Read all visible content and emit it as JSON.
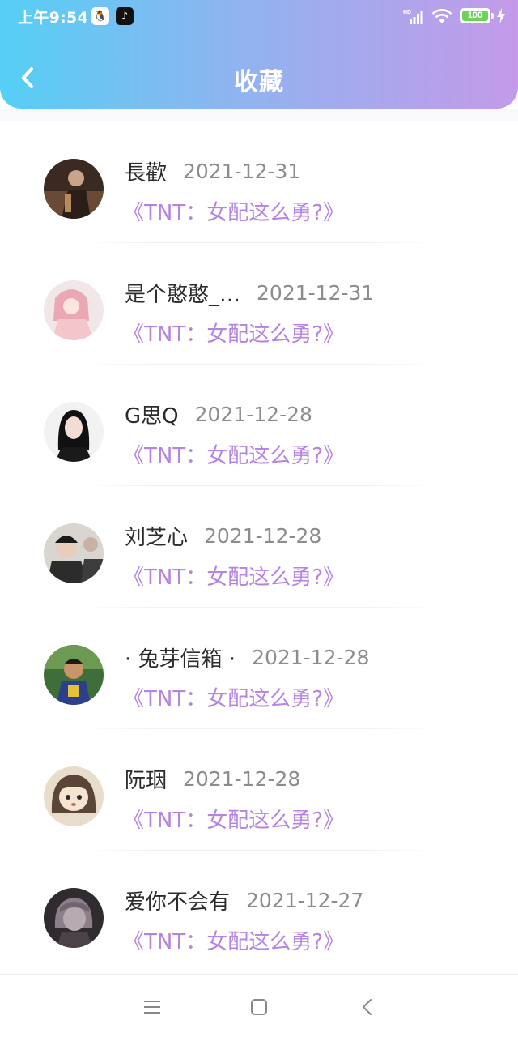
{
  "status_bar": {
    "time": "上午9:54",
    "battery": "100",
    "network": "HD"
  },
  "header": {
    "title": "收藏",
    "back_icon": "chevron-left-icon"
  },
  "favorites": [
    {
      "user": "長歡",
      "date": "2021-12-31",
      "title": "《TNT：女配这么勇?》"
    },
    {
      "user": "是个憨憨_…",
      "date": "2021-12-31",
      "title": "《TNT：女配这么勇?》"
    },
    {
      "user": "G思Q",
      "date": "2021-12-28",
      "title": "《TNT：女配这么勇?》"
    },
    {
      "user": "刘芝心",
      "date": "2021-12-28",
      "title": "《TNT：女配这么勇?》"
    },
    {
      "user": "· 兔芽信箱 ·",
      "date": "2021-12-28",
      "title": "《TNT：女配这么勇?》"
    },
    {
      "user": "阮珚",
      "date": "2021-12-28",
      "title": "《TNT：女配这么勇?》"
    },
    {
      "user": "爱你不会有",
      "date": "2021-12-27",
      "title": "《TNT：女配这么勇?》"
    }
  ],
  "colors": {
    "header_gradient_start": "#55cff5",
    "header_gradient_end": "#c49ae9",
    "accent_title": "#b583e2",
    "battery": "#6bd35a"
  },
  "nav_bar": {
    "icons": [
      "menu-icon",
      "home-square-icon",
      "back-triangle-icon"
    ]
  }
}
